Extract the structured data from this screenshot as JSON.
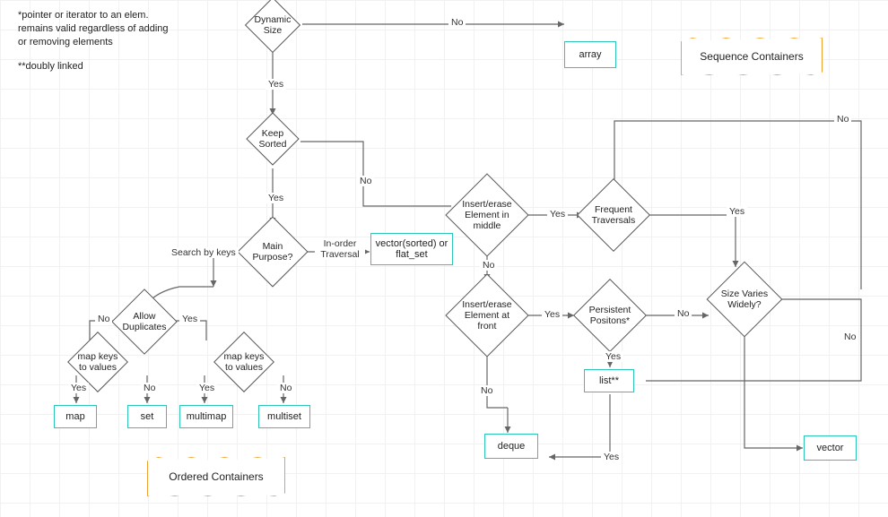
{
  "annotations": {
    "line1": "*pointer or iterator to an elem. remains valid regardless of adding or removing elements",
    "line2": "**doubly linked"
  },
  "decisions": {
    "dynamic_size": "Dynamic Size",
    "keep_sorted": "Keep Sorted",
    "main_purpose": "Main Purpose?",
    "allow_duplicates": "Allow Duplicates",
    "map_kv_left": "map keys to values",
    "map_kv_right": "map keys to values",
    "insert_middle": "Insert/erase Element in middle",
    "insert_front": "Insert/erase Element at front",
    "frequent_traversals": "Frequent Traversals",
    "persistent_positions": "Persistent Positons*",
    "size_varies": "Size Varies Widely?"
  },
  "terminals": {
    "array": "array",
    "vector_sorted": "vector(sorted) or flat_set",
    "map": "map",
    "set": "set",
    "multimap": "multimap",
    "multiset": "multiset",
    "list": "list**",
    "deque": "deque",
    "vector": "vector"
  },
  "banners": {
    "sequence": "Sequence Containers",
    "ordered": "Ordered Containers"
  },
  "labels": {
    "no": "No",
    "yes": "Yes",
    "inorder": "In-order Traversal",
    "search_keys": "Search by keys"
  }
}
